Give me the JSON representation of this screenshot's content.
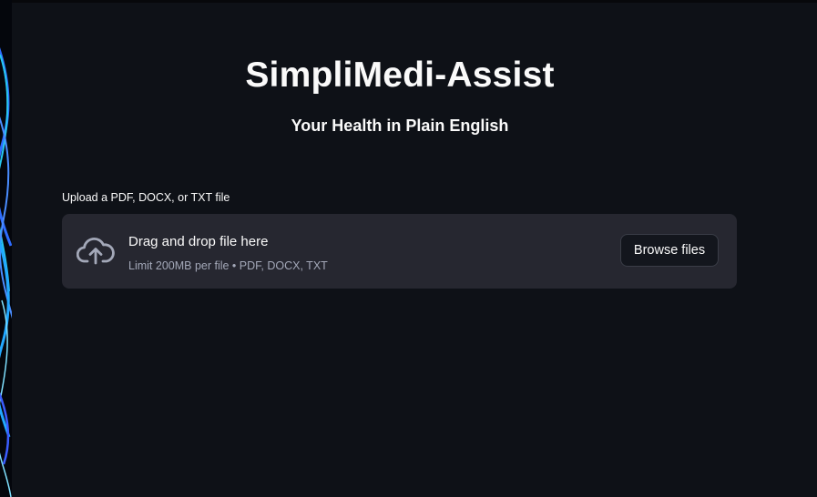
{
  "app": {
    "title": "SimpliMedi-Assist",
    "subtitle": "Your Health in Plain English"
  },
  "uploader": {
    "label": "Upload a PDF, DOCX, or TXT file",
    "drop_title": "Drag and drop file here",
    "drop_hint": "Limit 200MB per file • PDF, DOCX, TXT",
    "button_label": "Browse files",
    "icon": "cloud-upload-icon"
  },
  "colors": {
    "background": "#0e1117",
    "dropzone": "#262730",
    "text": "#fafafa",
    "muted_text": "#a3a8b8"
  }
}
